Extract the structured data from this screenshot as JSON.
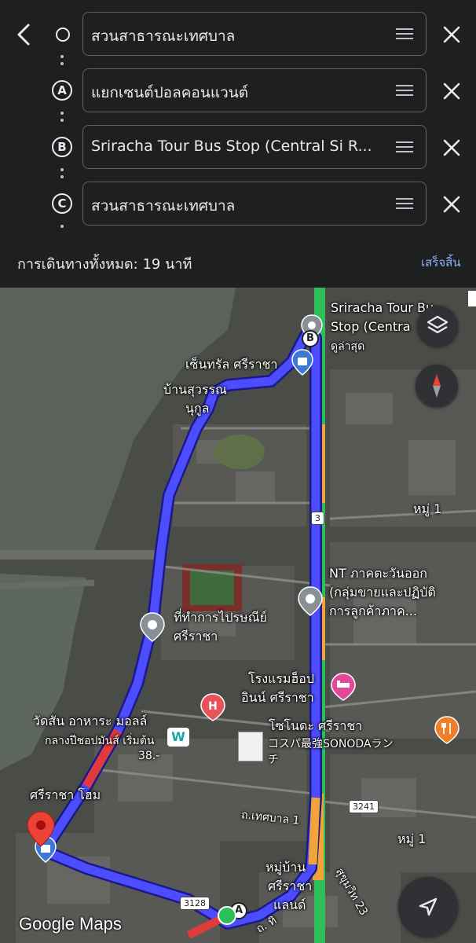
{
  "header": {
    "stops": [
      {
        "marker": "",
        "name": "สวนสาธารณะเทศบาล"
      },
      {
        "marker": "A",
        "name": "แยกเซนต์ปอลคอนแวนต์"
      },
      {
        "marker": "B",
        "name": "Sriracha Tour Bus Stop (Central Si R..."
      },
      {
        "marker": "C",
        "name": "สวนสาธารณะเทศบาล"
      }
    ],
    "total_label": "การเดินทางทั้งหมด: 19 นาที",
    "done_label": "เสร็จสิ้น"
  },
  "map": {
    "labels": {
      "bus_stop_1": "Sriracha Tour Bu",
      "bus_stop_2": "Stop (Centra",
      "bus_stop_3": "ดูล่าสุด",
      "central": "เซ็นทรัล ศรีราชา",
      "baan_suwan_1": "บ้านสุวรรณ",
      "baan_suwan_2": "นุกูล",
      "moo1_a": "หมู่ 1",
      "nt_1": "NT ภาคตะวันออก",
      "nt_2": "(กลุ่มขายและปฏิบัติ",
      "nt_3": "การลูกค้าภาค...",
      "post_1": "ที่ทำการไปรษณีย์",
      "post_2": "ศรีราชา",
      "hotel_1": "โรงแรมฮ็อป",
      "hotel_2": "อินน์ ศรีราชา",
      "sonoda_1": "โซโนดะ ศรีราชา",
      "sonoda_2": "コスパ最強SONODAラン",
      "sonoda_3": "チ",
      "wat_1": "วัดสัน อาหาระ มอลล์",
      "wat_2": "กลางปีชอปมันส์ เริ่มต้น",
      "wat_3": "38.-",
      "home": "ศรีราชา โฮม",
      "road_thesaban": "ถ.เทศบาล 1",
      "moo1_b": "หมู่ 1",
      "village_1": "หมู่บ้าน",
      "village_2": "ศรีราชา",
      "village_3": "แลนด์",
      "sukhumvit": "สุขุมวิท 23",
      "road_bottom": "ถ. ทิ"
    },
    "shields": {
      "route3": "3",
      "route3241": "3241",
      "route3128": "3128"
    },
    "markers": {
      "a": "A",
      "b": "B",
      "hospital": "H"
    },
    "logo": "Google Maps",
    "colors": {
      "route": "#4d4dff",
      "traffic_orange": "#f2a33a",
      "traffic_red": "#e03a3a",
      "traffic_green": "#2fbf5a",
      "pin_red": "#ea4335"
    }
  }
}
